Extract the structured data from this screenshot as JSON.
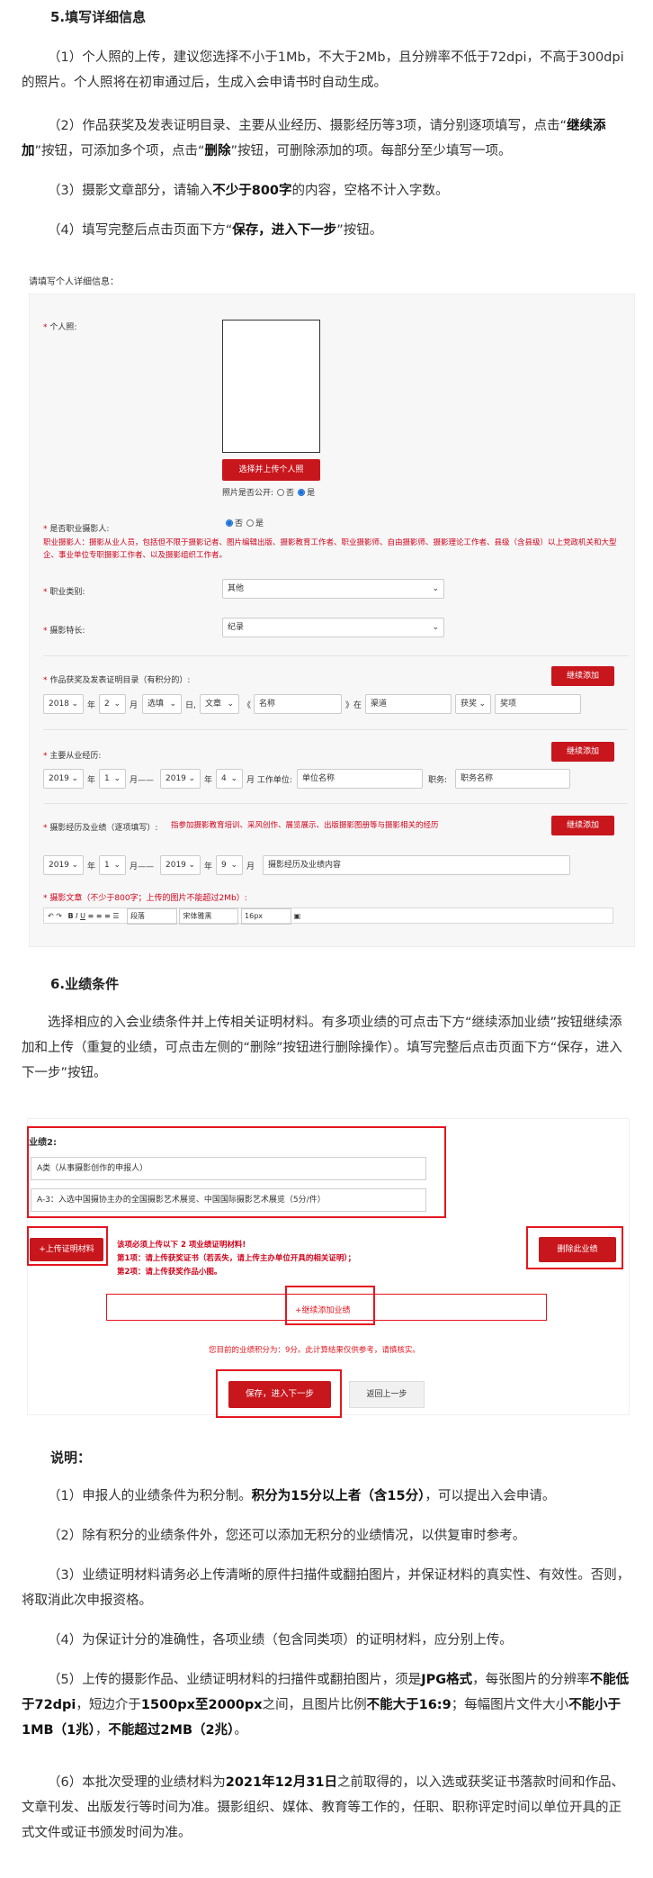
{
  "section5": {
    "title": "5.填写详细信息",
    "p1": "（1）个人照的上传，建议您选择不小于1Mb，不大于2Mb，且分辨率不低于72dpi，不高于300dpi的照片。个人照将在初审通过后，生成入会申请书时自动生成。",
    "p2_a": "（2）作品获奖及发表证明目录、主要从业经历、摄影经历等3项，请分别逐项填写，点击“",
    "p2_b": "继续添加",
    "p2_c": "”按钮，可添加多个项，点击“",
    "p2_d": "删除",
    "p2_e": "”按钮，可删除添加的项。每部分至少填写一项。",
    "p3_a": "（3）摄影文章部分，请输入",
    "p3_b": "不少于800字",
    "p3_c": "的内容，空格不计入字数。",
    "p4_a": "（4）填写完整后点击页面下方“",
    "p4_b": "保存，进入下一步",
    "p4_c": "”按钮。"
  },
  "form": {
    "page_title": "请填写个人详细信息：",
    "photo_label": "个人照:",
    "upload_btn": "选择并上传个人照",
    "photo_public": "照片是否公开:",
    "opt_no": "否",
    "opt_yes": "是",
    "pro_label": "是否职业摄影人:",
    "pro_note": "职业摄影人：摄影从业人员，包括但不限于摄影记者、图片编辑出版、摄影教育工作者、职业摄影师、自由摄影师、摄影理论工作者、县级（含县级）以上党政机关和大型企、事业单位专职摄影工作者、以及摄影组织工作者。",
    "category_label": "职业类别:",
    "category_value": "其他",
    "specialty_label": "摄影特长:",
    "specialty_value": "纪录",
    "awards_label": "作品获奖及发表证明目录（有积分的）:",
    "continue_add": "继续添加",
    "awards_row": {
      "year": "2018",
      "month": "2",
      "day": "选填",
      "type": "文章",
      "name": "名称",
      "place": "渠道",
      "prize": "获奖",
      "prize_ph": "奖项",
      "t_year": "年",
      "t_month": "月",
      "t_day": "日,",
      "t_open": "《",
      "t_close": "》在"
    },
    "career_label": "主要从业经历:",
    "career_row": {
      "y1": "2019",
      "m1": "1",
      "y2": "2019",
      "m2": "4",
      "unit_label": "工作单位:",
      "unit_ph": "单位名称",
      "job_label": "职务:",
      "job_ph": "职务名称",
      "t_year": "年",
      "t_month": "月——",
      "t_month2": "月"
    },
    "exp_label": "摄影经历及业绩（逐项填写）:",
    "exp_note": "指参加摄影教育培训、采风创作、展览展示、出版摄影图册等与摄影相关的经历",
    "exp_row": {
      "y1": "2019",
      "m1": "1",
      "y2": "2019",
      "m2": "9",
      "content_ph": "摄影经历及业绩内容"
    },
    "article_label": "摄影文章（不少于800字；上传的图片不能超过2Mb）:",
    "toolbar": {
      "para": "段落",
      "font": "宋体雅黑",
      "size": "16px"
    }
  },
  "section6": {
    "title": "6.业绩条件",
    "p1": "选择相应的入会业绩条件并上传相关证明材料。有多项业绩的可点击下方“继续添加业绩”按钮继续添加和上传（重复的业绩，可点击左侧的“删除”按钮进行删除操作）。填写完整后点击页面下方“保存，进入下一步”按钮。"
  },
  "shot2": {
    "heading": "业绩2:",
    "sel1": "A类（从事摄影创作的申报人）",
    "sel2": "A-3：入选中国摄协主办的全国摄影艺术展览、中国国际摄影艺术展览（5分/件）",
    "upload_btn": "+上传证明材料",
    "note1": "该项必须上传以下 2 项业绩证明材料!",
    "note2": "第1项：请上传获奖证书（若丢失，请上传主办单位开具的相关证明）；",
    "note3": "第2项：请上传获奖作品小图。",
    "delete_btn": "删除此业绩",
    "add_btn": "+继续添加业绩",
    "score": "您目前的业绩积分为：9分。此计算结果仅供参考，请慎核实。",
    "save_btn": "保存，进入下一步",
    "back_btn": "返回上一步"
  },
  "notes": {
    "title": "说明：",
    "n1_a": "（1）申报人的业绩条件为积分制。",
    "n1_b": "积分为15分以上者（含15分）",
    "n1_c": "，可以提出入会申请。",
    "n2": "（2）除有积分的业绩条件外，您还可以添加无积分的业绩情况，以供复审时参考。",
    "n3": "（3）业绩证明材料请务必上传清晰的原件扫描件或翻拍图片，并保证材料的真实性、有效性。否则，将取消此次申报资格。",
    "n4": "（4）为保证计分的准确性，各项业绩（包含同类项）的证明材料，应分别上传。",
    "n5_a": "（5）上传的摄影作品、业绩证明材料的扫描件或翻拍图片，须是",
    "n5_b": "JPG格式",
    "n5_c": "，每张图片的分辨率",
    "n5_d": "不能低于72dpi",
    "n5_e": "，短边介于",
    "n5_f": "1500px至2000px",
    "n5_g": "之间，且图片比例",
    "n5_h": "不能大于16:9",
    "n5_i": "；每幅图片文件大小",
    "n5_j": "不能小于1MB（1兆）",
    "n5_k": "，",
    "n5_l": "不能超过2MB（2兆）",
    "n5_m": "。",
    "n6_a": "（6）本批次受理的业绩材料为",
    "n6_b": "2021年12月31日",
    "n6_c": "之前取得的，以入选或获奖证书落款时间和作品、文章刊发、出版发行等时间为准。摄影组织、媒体、教育等工作的，任职、职称评定时间以单位开具的正式文件或证书颁发时间为准。"
  }
}
